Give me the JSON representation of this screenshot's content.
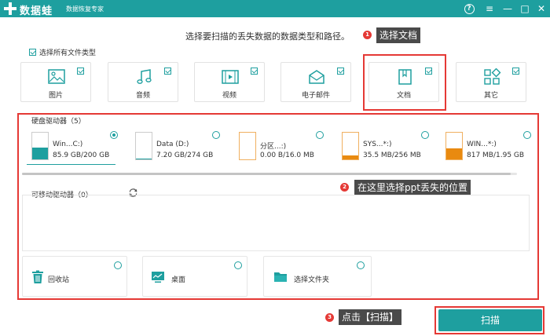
{
  "app": {
    "name": "数据蛙",
    "subtitle": "数据恢复专家"
  },
  "titlebar": {
    "help": "?",
    "menu": "≡",
    "minimize": "—",
    "maximize": "□",
    "close": "✕"
  },
  "instruction": "选择要扫描的丢失数据的数据类型和路径。",
  "select_all_label": "选择所有文件类型",
  "file_types": [
    {
      "label": "图片",
      "icon": "image-icon"
    },
    {
      "label": "音频",
      "icon": "music-icon"
    },
    {
      "label": "视频",
      "icon": "video-icon"
    },
    {
      "label": "电子邮件",
      "icon": "email-icon"
    },
    {
      "label": "文档",
      "icon": "document-icon"
    },
    {
      "label": "其它",
      "icon": "other-icon"
    }
  ],
  "callouts": [
    {
      "num": "1",
      "text": "选择文档"
    },
    {
      "num": "2",
      "text": "在这里选择ppt丢失的位置"
    },
    {
      "num": "3",
      "text": "点击【扫描】"
    }
  ],
  "hard_drives": {
    "title": "硬盘驱动器（5）",
    "items": [
      {
        "name": "Win...C:)",
        "size": "85.9 GB/200 GB",
        "selected": true,
        "usage": 0.43,
        "color": "#1e9f9f"
      },
      {
        "name": "Data (D:)",
        "size": "7.20 GB/274 GB",
        "selected": false,
        "usage": 0.03,
        "color": "#1e9f9f"
      },
      {
        "name": "分区...:)",
        "size": "0.00  B/16.0 MB",
        "selected": false,
        "usage": 0.0,
        "color": "#f0a030"
      },
      {
        "name": "SYS...*:)",
        "size": "35.5 MB/256 MB",
        "selected": false,
        "usage": 0.14,
        "color": "#e98a10"
      },
      {
        "name": "WIN...*:)",
        "size": "817 MB/1.95 GB",
        "selected": false,
        "usage": 0.42,
        "color": "#e98a10"
      }
    ]
  },
  "removable": {
    "title": "可移动驱动器（0）"
  },
  "locations": [
    {
      "label": "回收站",
      "icon": "recycle-bin-icon"
    },
    {
      "label": "桌面",
      "icon": "desktop-icon"
    },
    {
      "label": "选择文件夹",
      "icon": "folder-icon"
    }
  ],
  "scan_label": "扫描",
  "colors": {
    "accent": "#1e9f9f",
    "highlight": "#e53935",
    "callout_bg": "#4a4a4a"
  }
}
